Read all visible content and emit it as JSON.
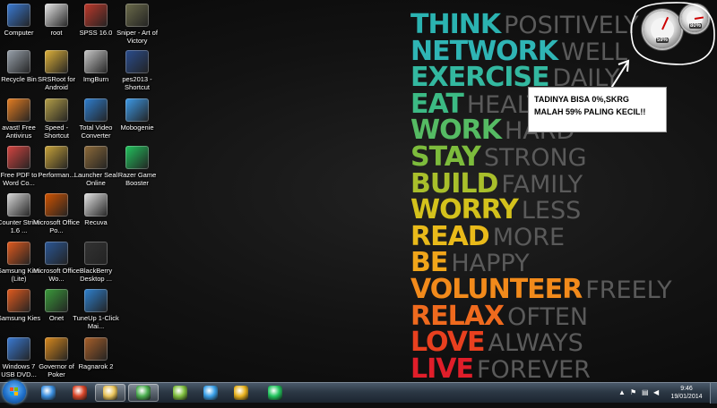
{
  "desktop_icons": [
    {
      "label": "Computer",
      "icon": "computer-icon",
      "color": "#3a7bd5",
      "col": 0,
      "row": 0
    },
    {
      "label": "root",
      "icon": "folder-icon",
      "color": "#e8e8e8",
      "col": 1,
      "row": 0
    },
    {
      "label": "SPSS 16.0",
      "icon": "spss-icon",
      "color": "#c0392b",
      "col": 2,
      "row": 0
    },
    {
      "label": "Sniper - Art of Victory",
      "icon": "game-icon",
      "color": "#6b6b4a",
      "col": 3,
      "row": 0
    },
    {
      "label": "Recycle Bin",
      "icon": "recycle-bin-icon",
      "color": "#9aa3ad",
      "col": 0,
      "row": 1
    },
    {
      "label": "SRSRoot for Android",
      "icon": "lock-icon",
      "color": "#e0b33a",
      "col": 1,
      "row": 1
    },
    {
      "label": "ImgBurn",
      "icon": "disc-icon",
      "color": "#c8c8c8",
      "col": 2,
      "row": 1
    },
    {
      "label": "pes2013 - Shortcut",
      "icon": "soccer-icon",
      "color": "#2a4d8f",
      "col": 3,
      "row": 1
    },
    {
      "label": "avast! Free Antivirus",
      "icon": "avast-icon",
      "color": "#e67e22",
      "col": 0,
      "row": 2
    },
    {
      "label": "Speed - Shortcut",
      "icon": "speed-icon",
      "color": "#b5a048",
      "col": 1,
      "row": 2
    },
    {
      "label": "Total Video Converter",
      "icon": "video-converter-icon",
      "color": "#2f7fd0",
      "col": 2,
      "row": 2
    },
    {
      "label": "Mobogenie",
      "icon": "mobogenie-icon",
      "color": "#3d9be9",
      "col": 3,
      "row": 2
    },
    {
      "label": "Free PDF to Word Co...",
      "icon": "pdf-icon",
      "color": "#d64541",
      "col": 0,
      "row": 3
    },
    {
      "label": "Performan...",
      "icon": "performance-icon",
      "color": "#c9a43a",
      "col": 1,
      "row": 3
    },
    {
      "label": "Launcher Seal Online",
      "icon": "launcher-icon",
      "color": "#8e6b3a",
      "col": 2,
      "row": 3
    },
    {
      "label": "Razer Game Booster",
      "icon": "razer-icon",
      "color": "#22c55e",
      "col": 3,
      "row": 3
    },
    {
      "label": "Counter Strike 1.6 ...",
      "icon": "counter-strike-icon",
      "color": "#d9d9d9",
      "col": 0,
      "row": 4
    },
    {
      "label": "Microsoft Office Po...",
      "icon": "powerpoint-icon",
      "color": "#d35400",
      "col": 1,
      "row": 4
    },
    {
      "label": "Recuva",
      "icon": "recuva-icon",
      "color": "#e5e5e5",
      "col": 2,
      "row": 4
    },
    {
      "label": "Samsung Kies (Lite)",
      "icon": "kies-icon",
      "color": "#e35b1e",
      "col": 0,
      "row": 5
    },
    {
      "label": "Microsoft Office Wo...",
      "icon": "word-icon",
      "color": "#2b5797",
      "col": 1,
      "row": 5
    },
    {
      "label": "BlackBerry Desktop ...",
      "icon": "blackberry-icon",
      "color": "#333333",
      "col": 2,
      "row": 5
    },
    {
      "label": "Samsung Kies",
      "icon": "kies-icon",
      "color": "#e35b1e",
      "col": 0,
      "row": 6
    },
    {
      "label": "Onet",
      "icon": "onet-icon",
      "color": "#3b9c3b",
      "col": 1,
      "row": 6
    },
    {
      "label": "TuneUp 1-Click Mai...",
      "icon": "tuneup-icon",
      "color": "#2f82d0",
      "col": 2,
      "row": 6
    },
    {
      "label": "Windows 7 USB DVD...",
      "icon": "usb-dvd-icon",
      "color": "#3a7bd5",
      "col": 0,
      "row": 7
    },
    {
      "label": "Governor of Poker",
      "icon": "poker-icon",
      "color": "#d98a1e",
      "col": 1,
      "row": 7
    },
    {
      "label": "Ragnarok 2",
      "icon": "ragnarok-icon",
      "color": "#a9602a",
      "col": 2,
      "row": 7
    }
  ],
  "poster": [
    {
      "big": "THINK",
      "small": "POSITIVELY",
      "color": "#2bb3b1"
    },
    {
      "big": "NETWORK",
      "small": "WELL",
      "color": "#2fb5b5"
    },
    {
      "big": "EXERCISE",
      "small": "DAILY",
      "color": "#33b8a0"
    },
    {
      "big": "EAT",
      "small": "HEALTHY",
      "color": "#3cba84"
    },
    {
      "big": "WORK",
      "small": "HARD",
      "color": "#55bb63"
    },
    {
      "big": "STAY",
      "small": "STRONG",
      "color": "#7dbc3c"
    },
    {
      "big": "BUILD",
      "small": "FAMILY",
      "color": "#a9bf2b"
    },
    {
      "big": "WORRY",
      "small": "LESS",
      "color": "#d4c21c"
    },
    {
      "big": "READ",
      "small": "MORE",
      "color": "#e9ba1a"
    },
    {
      "big": "BE",
      "small": "HAPPY",
      "color": "#f0a51a"
    },
    {
      "big": "VOLUNTEER",
      "small": "FREELY",
      "color": "#f28a1b"
    },
    {
      "big": "RELAX",
      "small": "OFTEN",
      "color": "#ef6a1e"
    },
    {
      "big": "LOVE",
      "small": "ALWAYS",
      "color": "#e8401f"
    },
    {
      "big": "LIVE",
      "small": "FOREVER",
      "color": "#e01e2a"
    }
  ],
  "gadget": {
    "cpu_label": "59%",
    "mem_label": "80%",
    "cpu_value": 0.59,
    "mem_value": 0.8
  },
  "annotation": {
    "line1": "TADINYA BISA 0%,SKRG",
    "line2": "MALAH 59% PALING KECIL!!"
  },
  "taskbar": {
    "items": [
      {
        "icon": "internet-explorer-icon",
        "color": "#3b8fe0"
      },
      {
        "icon": "media-player-icon",
        "color": "#d9472b"
      },
      {
        "icon": "file-explorer-icon",
        "color": "#e8c35a",
        "active": true
      },
      {
        "icon": "chrome-icon",
        "color": "#4caf50",
        "active": true
      },
      {
        "icon": "app-icon",
        "color": "#7fbf3f"
      },
      {
        "icon": "twitter-icon",
        "color": "#3aa0e8"
      },
      {
        "icon": "puzzle-icon",
        "color": "#e8b21e"
      },
      {
        "icon": "razer-icon",
        "color": "#22c55e"
      }
    ],
    "time": "9:46",
    "date": "19/01/2014"
  }
}
